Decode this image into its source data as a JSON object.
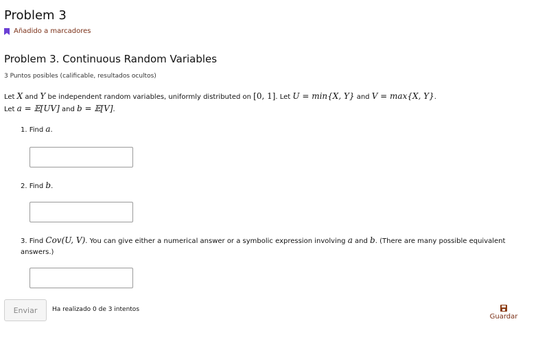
{
  "header": {
    "title": "Problem 3",
    "bookmark_label": "Añadido a marcadores"
  },
  "problem": {
    "heading": "Problem 3. Continuous Random Variables",
    "points": "3 Puntos posibles (calificable, resultados ocultos)",
    "statement": {
      "line1_let": "Let ",
      "x": "X",
      "and1": " and ",
      "y": "Y",
      "line1_rest": " be independent random variables, uniformly distributed on ",
      "interval": "[0, 1]",
      "let_u": ". Let ",
      "u_def": "U = min{X, Y}",
      "and2": " and ",
      "v_def": "V = max{X, Y}",
      "period1": ".",
      "line2_let": "Let ",
      "a_def": "a = 𝔼[UV]",
      "and3": " and ",
      "b_def": "b = 𝔼[V]",
      "period2": "."
    },
    "questions": [
      {
        "number": "1. Find ",
        "var": "a",
        "end": "."
      },
      {
        "number": "2. Find ",
        "var": "b",
        "end": "."
      },
      {
        "number": "3. Find ",
        "cov": "Cov(U, V)",
        "text1": ". You can give either a numerical answer or a symbolic expression involving ",
        "a": "a",
        "and": " and ",
        "b": "b",
        "text2": ". (There are many possible equivalent answers.)"
      }
    ],
    "answers": [
      "",
      "",
      ""
    ]
  },
  "footer": {
    "submit_label": "Enviar",
    "attempts_text": "Ha realizado 0 de 3 intentos",
    "save_label": "Guardar"
  },
  "colors": {
    "bookmark": "#6b3fd4",
    "accent_text": "#7a2f16",
    "save_icon": "#8a3a10"
  }
}
